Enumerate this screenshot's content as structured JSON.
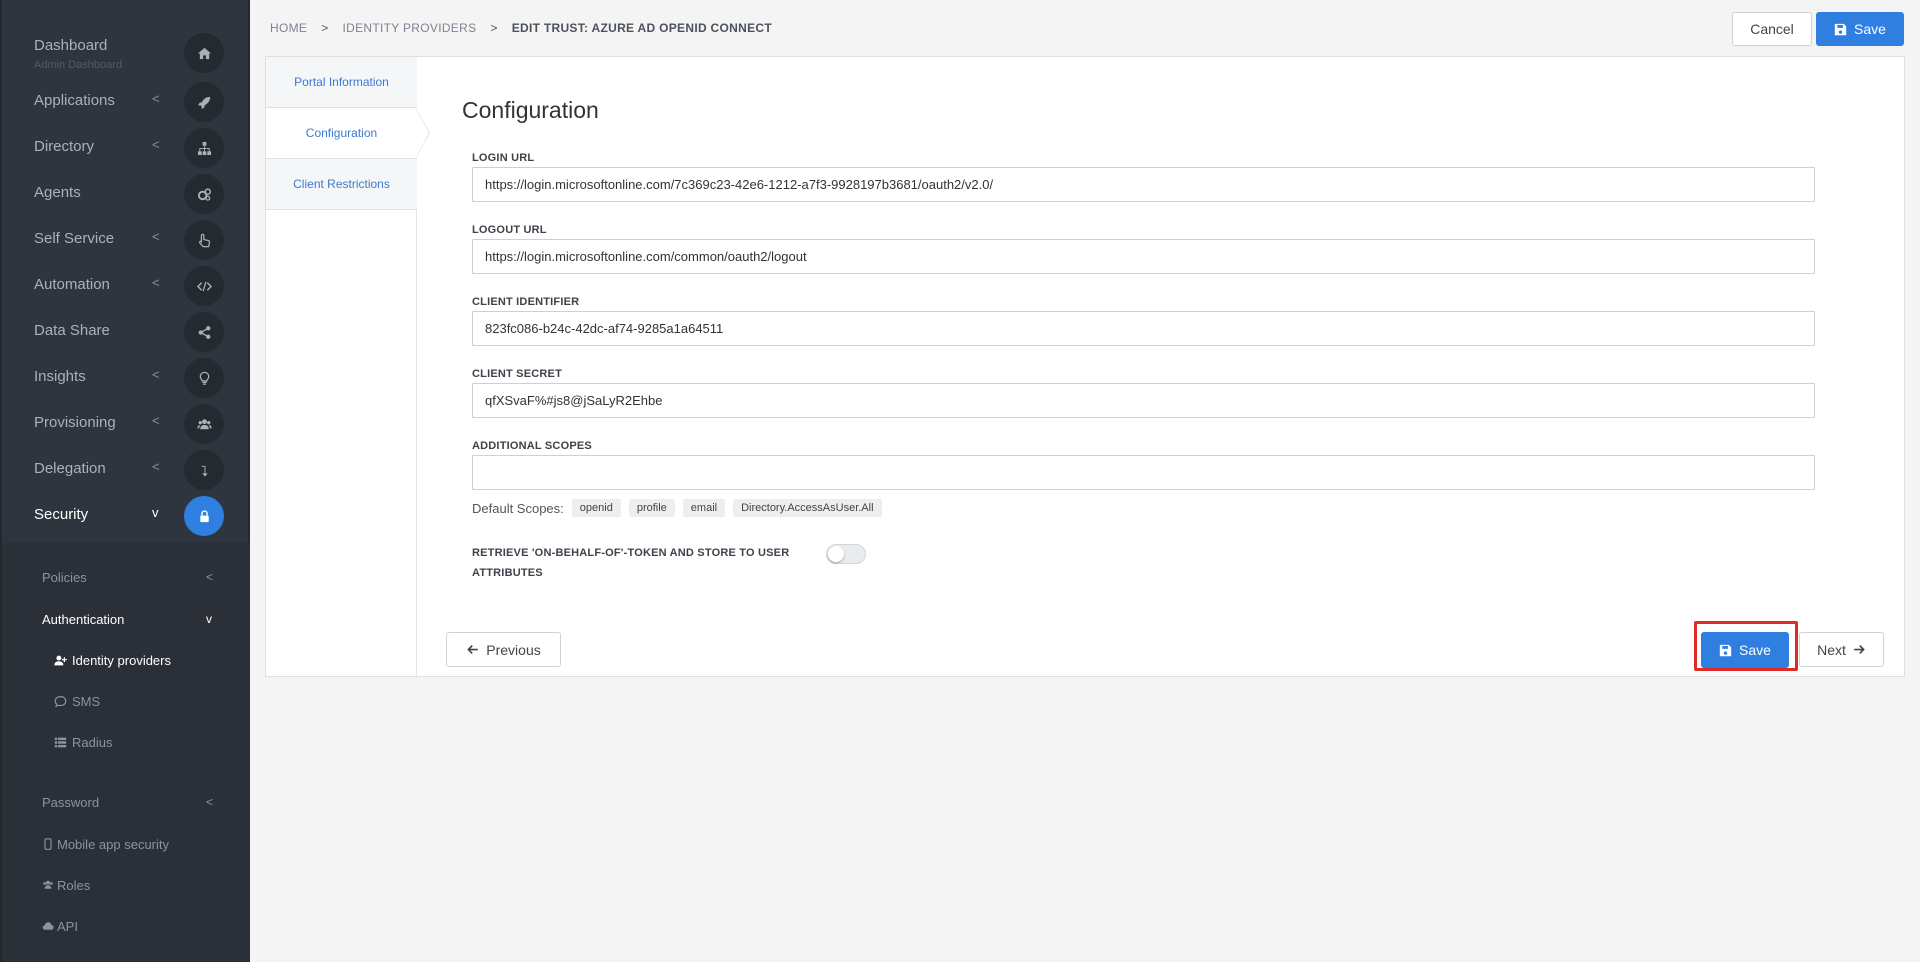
{
  "sidebar": {
    "items": [
      {
        "label": "Dashboard",
        "sub": "Admin Dashboard",
        "icon": "home-icon",
        "chevron": ""
      },
      {
        "label": "Applications",
        "icon": "rocket-icon",
        "chevron": "<"
      },
      {
        "label": "Directory",
        "icon": "sitemap-icon",
        "chevron": "<"
      },
      {
        "label": "Agents",
        "icon": "cogs-icon",
        "chevron": ""
      },
      {
        "label": "Self Service",
        "icon": "hand-pointer-icon",
        "chevron": "<"
      },
      {
        "label": "Automation",
        "icon": "code-icon",
        "chevron": "<"
      },
      {
        "label": "Data Share",
        "icon": "share-icon",
        "chevron": ""
      },
      {
        "label": "Insights",
        "icon": "lightbulb-icon",
        "chevron": "<"
      },
      {
        "label": "Provisioning",
        "icon": "users-icon",
        "chevron": "<"
      },
      {
        "label": "Delegation",
        "icon": "level-down-icon",
        "chevron": "<"
      },
      {
        "label": "Security",
        "icon": "lock-icon",
        "chevron": "v"
      }
    ],
    "subnav": {
      "policies": "Policies",
      "authentication": "Authentication",
      "identity_providers": "Identity providers",
      "sms": "SMS",
      "radius": "Radius",
      "password": "Password",
      "mobile_app_security": "Mobile app security",
      "roles": "Roles",
      "api": "API"
    }
  },
  "breadcrumb": {
    "home": "HOME",
    "identity_providers": "IDENTITY PROVIDERS",
    "current": "EDIT TRUST: AZURE AD OPENID CONNECT"
  },
  "header": {
    "cancel_label": "Cancel",
    "save_label": "Save"
  },
  "tabs": [
    {
      "label": "Portal Information"
    },
    {
      "label": "Configuration"
    },
    {
      "label": "Client Restrictions"
    }
  ],
  "panel": {
    "title": "Configuration",
    "login_url_label": "LOGIN URL",
    "login_url_value": "https://login.microsoftonline.com/7c369c23-42e6-1212-a7f3-9928197b3681/oauth2/v2.0/",
    "logout_url_label": "LOGOUT URL",
    "logout_url_value": "https://login.microsoftonline.com/common/oauth2/logout",
    "client_id_label": "CLIENT IDENTIFIER",
    "client_id_value": "823fc086-b24c-42dc-af74-9285a1a64511",
    "client_secret_label": "CLIENT SECRET",
    "client_secret_value": "qfXSvaF%#js8@jSaLyR2Ehbe",
    "additional_scopes_label": "ADDITIONAL SCOPES",
    "additional_scopes_value": "",
    "default_scopes_label": "Default Scopes:",
    "default_scopes": [
      "openid",
      "profile",
      "email",
      "Directory.AccessAsUser.All"
    ],
    "obo_label": "RETRIEVE 'ON-BEHALF-OF'-TOKEN AND STORE TO USER ATTRIBUTES",
    "obo_enabled": false
  },
  "footer": {
    "previous_label": "Previous",
    "save_label": "Save",
    "next_label": "Next"
  },
  "colors": {
    "accent": "#2e7fe0",
    "sidebar_bg": "#2f353f",
    "highlight": "#e02a2a"
  }
}
